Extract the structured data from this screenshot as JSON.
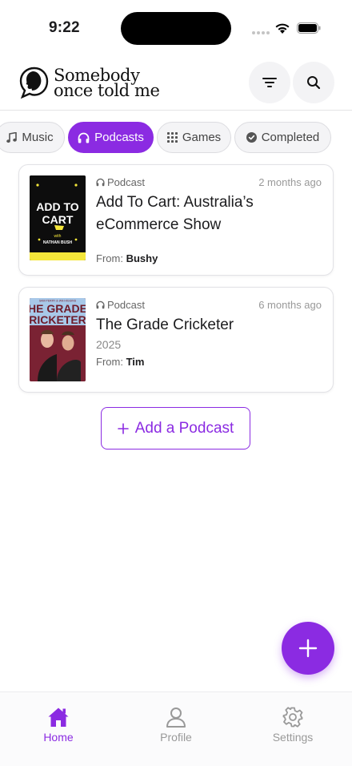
{
  "status_bar": {
    "time": "9:22"
  },
  "header": {
    "logo_line1": "Somebody",
    "logo_line2": "once told me"
  },
  "chips": [
    {
      "label": "Music",
      "icon": "music-note-icon",
      "active": false
    },
    {
      "label": "Podcasts",
      "icon": "headphones-icon",
      "active": true
    },
    {
      "label": "Games",
      "icon": "grid-icon",
      "active": false
    },
    {
      "label": "Completed",
      "icon": "check-circle-icon",
      "active": false
    }
  ],
  "items": [
    {
      "type": "Podcast",
      "time_ago": "2 months ago",
      "title": "Add To Cart: Australia’s eCommerce Show",
      "year": "",
      "from_label": "From:",
      "from_name": "Bushy",
      "cover_text_1": "ADD TO",
      "cover_text_2": "CART",
      "cover_text_3": "with",
      "cover_text_4": "NATHAN BUSH"
    },
    {
      "type": "Podcast",
      "time_ago": "6 months ago",
      "title": "The Grade Cricketer",
      "year": "2025",
      "from_label": "From:",
      "from_name": "Tim",
      "cover_text_1": "HE GRADE",
      "cover_text_2": "RICKETER",
      "cover_text_3": "SAM PERRY & IAN HIGGINS"
    }
  ],
  "add_button": {
    "label": "Add a Podcast"
  },
  "tabbar": {
    "home": "Home",
    "profile": "Profile",
    "settings": "Settings"
  },
  "colors": {
    "accent": "#8b2be2",
    "text": "#1c1c1e",
    "muted": "#999999"
  }
}
